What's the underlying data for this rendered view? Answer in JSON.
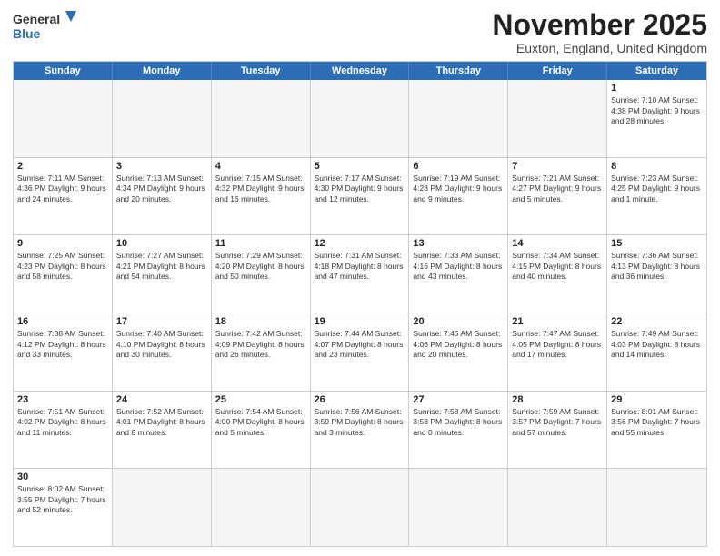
{
  "header": {
    "logo_line1": "General",
    "logo_line2": "Blue",
    "month_title": "November 2025",
    "subtitle": "Euxton, England, United Kingdom"
  },
  "days_of_week": [
    "Sunday",
    "Monday",
    "Tuesday",
    "Wednesday",
    "Thursday",
    "Friday",
    "Saturday"
  ],
  "weeks": [
    [
      {
        "day": "",
        "info": ""
      },
      {
        "day": "",
        "info": ""
      },
      {
        "day": "",
        "info": ""
      },
      {
        "day": "",
        "info": ""
      },
      {
        "day": "",
        "info": ""
      },
      {
        "day": "",
        "info": ""
      },
      {
        "day": "1",
        "info": "Sunrise: 7:10 AM\nSunset: 4:38 PM\nDaylight: 9 hours and 28 minutes."
      }
    ],
    [
      {
        "day": "2",
        "info": "Sunrise: 7:11 AM\nSunset: 4:36 PM\nDaylight: 9 hours and 24 minutes."
      },
      {
        "day": "3",
        "info": "Sunrise: 7:13 AM\nSunset: 4:34 PM\nDaylight: 9 hours and 20 minutes."
      },
      {
        "day": "4",
        "info": "Sunrise: 7:15 AM\nSunset: 4:32 PM\nDaylight: 9 hours and 16 minutes."
      },
      {
        "day": "5",
        "info": "Sunrise: 7:17 AM\nSunset: 4:30 PM\nDaylight: 9 hours and 12 minutes."
      },
      {
        "day": "6",
        "info": "Sunrise: 7:19 AM\nSunset: 4:28 PM\nDaylight: 9 hours and 9 minutes."
      },
      {
        "day": "7",
        "info": "Sunrise: 7:21 AM\nSunset: 4:27 PM\nDaylight: 9 hours and 5 minutes."
      },
      {
        "day": "8",
        "info": "Sunrise: 7:23 AM\nSunset: 4:25 PM\nDaylight: 9 hours and 1 minute."
      }
    ],
    [
      {
        "day": "9",
        "info": "Sunrise: 7:25 AM\nSunset: 4:23 PM\nDaylight: 8 hours and 58 minutes."
      },
      {
        "day": "10",
        "info": "Sunrise: 7:27 AM\nSunset: 4:21 PM\nDaylight: 8 hours and 54 minutes."
      },
      {
        "day": "11",
        "info": "Sunrise: 7:29 AM\nSunset: 4:20 PM\nDaylight: 8 hours and 50 minutes."
      },
      {
        "day": "12",
        "info": "Sunrise: 7:31 AM\nSunset: 4:18 PM\nDaylight: 8 hours and 47 minutes."
      },
      {
        "day": "13",
        "info": "Sunrise: 7:33 AM\nSunset: 4:16 PM\nDaylight: 8 hours and 43 minutes."
      },
      {
        "day": "14",
        "info": "Sunrise: 7:34 AM\nSunset: 4:15 PM\nDaylight: 8 hours and 40 minutes."
      },
      {
        "day": "15",
        "info": "Sunrise: 7:36 AM\nSunset: 4:13 PM\nDaylight: 8 hours and 36 minutes."
      }
    ],
    [
      {
        "day": "16",
        "info": "Sunrise: 7:38 AM\nSunset: 4:12 PM\nDaylight: 8 hours and 33 minutes."
      },
      {
        "day": "17",
        "info": "Sunrise: 7:40 AM\nSunset: 4:10 PM\nDaylight: 8 hours and 30 minutes."
      },
      {
        "day": "18",
        "info": "Sunrise: 7:42 AM\nSunset: 4:09 PM\nDaylight: 8 hours and 26 minutes."
      },
      {
        "day": "19",
        "info": "Sunrise: 7:44 AM\nSunset: 4:07 PM\nDaylight: 8 hours and 23 minutes."
      },
      {
        "day": "20",
        "info": "Sunrise: 7:45 AM\nSunset: 4:06 PM\nDaylight: 8 hours and 20 minutes."
      },
      {
        "day": "21",
        "info": "Sunrise: 7:47 AM\nSunset: 4:05 PM\nDaylight: 8 hours and 17 minutes."
      },
      {
        "day": "22",
        "info": "Sunrise: 7:49 AM\nSunset: 4:03 PM\nDaylight: 8 hours and 14 minutes."
      }
    ],
    [
      {
        "day": "23",
        "info": "Sunrise: 7:51 AM\nSunset: 4:02 PM\nDaylight: 8 hours and 11 minutes."
      },
      {
        "day": "24",
        "info": "Sunrise: 7:52 AM\nSunset: 4:01 PM\nDaylight: 8 hours and 8 minutes."
      },
      {
        "day": "25",
        "info": "Sunrise: 7:54 AM\nSunset: 4:00 PM\nDaylight: 8 hours and 5 minutes."
      },
      {
        "day": "26",
        "info": "Sunrise: 7:56 AM\nSunset: 3:59 PM\nDaylight: 8 hours and 3 minutes."
      },
      {
        "day": "27",
        "info": "Sunrise: 7:58 AM\nSunset: 3:58 PM\nDaylight: 8 hours and 0 minutes."
      },
      {
        "day": "28",
        "info": "Sunrise: 7:59 AM\nSunset: 3:57 PM\nDaylight: 7 hours and 57 minutes."
      },
      {
        "day": "29",
        "info": "Sunrise: 8:01 AM\nSunset: 3:56 PM\nDaylight: 7 hours and 55 minutes."
      }
    ],
    [
      {
        "day": "30",
        "info": "Sunrise: 8:02 AM\nSunset: 3:55 PM\nDaylight: 7 hours and 52 minutes."
      },
      {
        "day": "",
        "info": ""
      },
      {
        "day": "",
        "info": ""
      },
      {
        "day": "",
        "info": ""
      },
      {
        "day": "",
        "info": ""
      },
      {
        "day": "",
        "info": ""
      },
      {
        "day": "",
        "info": ""
      }
    ]
  ]
}
